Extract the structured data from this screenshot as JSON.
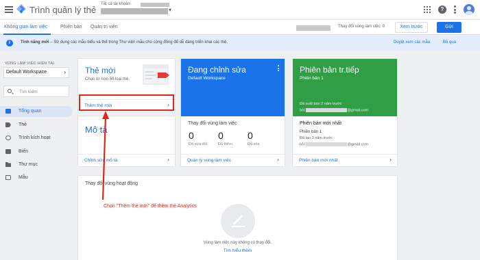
{
  "header": {
    "app_title": "Trình quản lý thẻ",
    "account_label": "Tất cả tài khoản",
    "icons": [
      "apps-icon",
      "help-icon",
      "more-vert-icon",
      "avatar"
    ]
  },
  "tabs": [
    {
      "label": "Không gian làm việc",
      "active": true
    },
    {
      "label": "Phiên bản",
      "active": false
    },
    {
      "label": "Quản trị viên",
      "active": false
    }
  ],
  "toolbar": {
    "changes_text": "Thay đổi vùng làm việc: 0",
    "preview_label": "Xem trước",
    "submit_label": "Gửi"
  },
  "banner": {
    "bold": "Tính năng mới",
    "text": " – Sử dụng các mẫu biểu và thể trong Thư viện mẫu cho cộng đồng để dễ dàng triển khai các thẻ.",
    "preview_link": "Duyệt xem các mẫu",
    "skip_link": "Bỏ qua"
  },
  "sidebar": {
    "workspace_label": "VÙNG LÀM VIỆC HIỆN TẠI",
    "workspace_value": "Default Workspace",
    "search_placeholder": "Tìm kiếm",
    "items": [
      {
        "label": "Tổng quan",
        "icon": "overview-icon",
        "active": true
      },
      {
        "label": "Thẻ",
        "icon": "tag-icon",
        "active": false
      },
      {
        "label": "Trình kích hoạt",
        "icon": "trigger-icon",
        "active": false
      },
      {
        "label": "Biến",
        "icon": "variable-icon",
        "active": false
      },
      {
        "label": "Thư mục",
        "icon": "folder-icon",
        "active": false
      },
      {
        "label": "Mẫu",
        "icon": "template-icon",
        "active": false
      }
    ]
  },
  "cards": {
    "new_tag": {
      "title": "Thẻ mới",
      "subtitle": "Chọn từ hơn 50 loại thẻ.",
      "footer": "Thêm thẻ mới"
    },
    "description": {
      "title": "Mô tả",
      "footer": "Chỉnh sửa mô tả"
    },
    "editing": {
      "title": "Đang chỉnh sửa",
      "subtitle": "Default Workspace",
      "section_title": "Thay đổi vùng làm việc",
      "stats": [
        {
          "value": "0",
          "label": "Đã sửa đổi"
        },
        {
          "value": "0",
          "label": "Đã thêm"
        },
        {
          "value": "0",
          "label": "Đã xóa"
        }
      ],
      "footer": "Quản lý vùng làm việc"
    },
    "live": {
      "title": "Phiên bản tr.tiếp",
      "subtitle": "Phiên bản 1",
      "published": "Đã xuất bản 2 năm trước",
      "by": "bởi",
      "email_suffix": "@gmail.com",
      "latest_title": "Phiên bản mới nhất",
      "latest_version": "Phiên bản 1",
      "created": "Đã tạo 2 năm trước",
      "footer": "Phiên bản mới nhất"
    }
  },
  "activity": {
    "title": "Thay đổi vùng hoạt động",
    "empty_text": "Vùng làm việc này không có thay đổi.",
    "learn_more": "Tìm hiểu thêm"
  },
  "annotation": {
    "text": "Chọn \"Thêm thẻ mới\" để thêm thẻ Analytics",
    "color": "#e0261b"
  },
  "colors": {
    "accent": "#1a73e8",
    "live_green": "#2f9e44",
    "annotation_red": "#e0261b"
  }
}
